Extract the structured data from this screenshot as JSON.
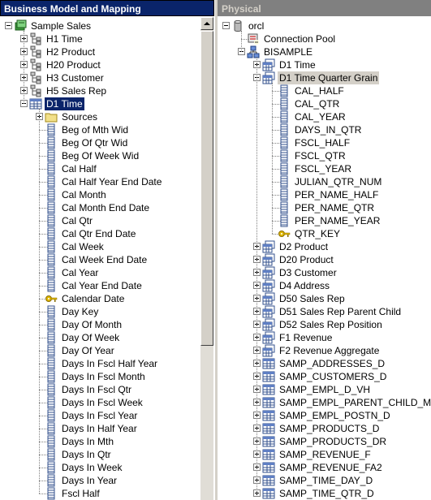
{
  "left_panel": {
    "title": "Business Model and Mapping",
    "root": "Sample Sales",
    "hierarchies": [
      "H1 Time",
      "H2 Product",
      "H20 Product",
      "H3 Customer",
      "H5 Sales Rep"
    ],
    "table_selected": "D1 Time",
    "folder": "Sources",
    "columns": [
      {
        "label": "Beg of Mth Wid",
        "key": false
      },
      {
        "label": "Beg Of Qtr Wid",
        "key": false
      },
      {
        "label": "Beg Of Week Wid",
        "key": false
      },
      {
        "label": "Cal Half",
        "key": false
      },
      {
        "label": "Cal Half Year End Date",
        "key": false
      },
      {
        "label": "Cal Month",
        "key": false
      },
      {
        "label": "Cal Month End Date",
        "key": false
      },
      {
        "label": "Cal Qtr",
        "key": false
      },
      {
        "label": "Cal Qtr End Date",
        "key": false
      },
      {
        "label": "Cal Week",
        "key": false
      },
      {
        "label": "Cal Week End Date",
        "key": false
      },
      {
        "label": "Cal Year",
        "key": false
      },
      {
        "label": "Cal Year End Date",
        "key": false
      },
      {
        "label": "Calendar Date",
        "key": true
      },
      {
        "label": "Day Key",
        "key": false
      },
      {
        "label": "Day Of Month",
        "key": false
      },
      {
        "label": "Day Of Week",
        "key": false
      },
      {
        "label": "Day Of Year",
        "key": false
      },
      {
        "label": "Days In Fscl Half Year",
        "key": false
      },
      {
        "label": "Days In Fscl Month",
        "key": false
      },
      {
        "label": "Days In Fscl Qtr",
        "key": false
      },
      {
        "label": "Days In Fscl Week",
        "key": false
      },
      {
        "label": "Days In Fscl Year",
        "key": false
      },
      {
        "label": "Days In Half Year",
        "key": false
      },
      {
        "label": "Days In Mth",
        "key": false
      },
      {
        "label": "Days In Qtr",
        "key": false
      },
      {
        "label": "Days In Week",
        "key": false
      },
      {
        "label": "Days In Year",
        "key": false
      },
      {
        "label": "Fscl Half",
        "key": false
      }
    ]
  },
  "right_panel": {
    "title": "Physical",
    "database": "orcl",
    "connection_pool": "Connection Pool",
    "schema": "BISAMPLE",
    "expanded_alias": "D1 Time Quarter Grain",
    "first_alias": "D1 Time",
    "alias_columns": [
      {
        "label": "CAL_HALF",
        "key": false
      },
      {
        "label": "CAL_QTR",
        "key": false
      },
      {
        "label": "CAL_YEAR",
        "key": false
      },
      {
        "label": "DAYS_IN_QTR",
        "key": false
      },
      {
        "label": "FSCL_HALF",
        "key": false
      },
      {
        "label": "FSCL_QTR",
        "key": false
      },
      {
        "label": "FSCL_YEAR",
        "key": false
      },
      {
        "label": "JULIAN_QTR_NUM",
        "key": false
      },
      {
        "label": "PER_NAME_HALF",
        "key": false
      },
      {
        "label": "PER_NAME_QTR",
        "key": false
      },
      {
        "label": "PER_NAME_YEAR",
        "key": false
      },
      {
        "label": "QTR_KEY",
        "key": true
      }
    ],
    "aliases": [
      "D2 Product",
      "D20 Product",
      "D3 Customer",
      "D4 Address",
      "D50 Sales Rep",
      "D51 Sales Rep Parent Child",
      "D52 Sales Rep Position",
      "F1 Revenue",
      "F2 Revenue Aggregate"
    ],
    "tables": [
      "SAMP_ADDRESSES_D",
      "SAMP_CUSTOMERS_D",
      "SAMP_EMPL_D_VH",
      "SAMP_EMPL_PARENT_CHILD_M...",
      "SAMP_EMPL_POSTN_D",
      "SAMP_PRODUCTS_D",
      "SAMP_PRODUCTS_DR",
      "SAMP_REVENUE_F",
      "SAMP_REVENUE_FA2",
      "SAMP_TIME_DAY_D",
      "SAMP_TIME_QTR_D"
    ]
  },
  "colors": {
    "selection": "#0a246a",
    "inactive_title": "#808080",
    "chrome": "#d4d0c8"
  }
}
